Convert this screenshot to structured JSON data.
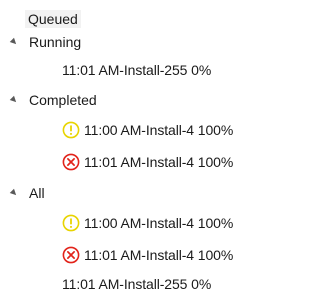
{
  "tree": {
    "root": {
      "label": "Queued"
    },
    "groups": [
      {
        "label": "Running",
        "items": [
          {
            "text": "11:01 AM-Install-255 0%",
            "icon": "none"
          }
        ]
      },
      {
        "label": "Completed",
        "items": [
          {
            "text": "11:00 AM-Install-4 100%",
            "icon": "warning-icon"
          },
          {
            "text": "11:01 AM-Install-4 100%",
            "icon": "error-icon"
          }
        ]
      },
      {
        "label": "All",
        "items": [
          {
            "text": "11:00 AM-Install-4 100%",
            "icon": "warning-icon"
          },
          {
            "text": "11:01 AM-Install-4 100%",
            "icon": "error-icon"
          },
          {
            "text": "11:01 AM-Install-255 0%",
            "icon": "none"
          }
        ]
      }
    ],
    "colors": {
      "warning": "#e8d400",
      "error": "#e2231a",
      "expander": "#595959"
    }
  }
}
